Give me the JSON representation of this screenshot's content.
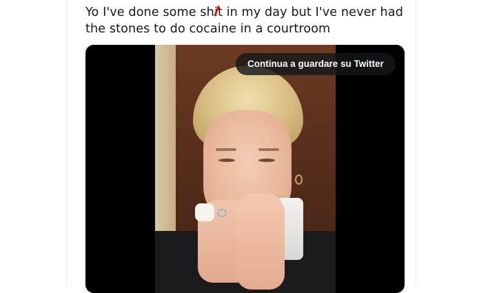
{
  "tweet": {
    "text_line1_before": "Yo I've done some sh",
    "text_line1_censored": "i",
    "text_line1_after": "t in my day but I've never had",
    "text_line2": "the stones to do cocaine in a courtroom"
  },
  "video": {
    "watch_on_twitter_label": "Continua a guardare su Twitter"
  },
  "colors": {
    "text": "#14171a",
    "censor_mark": "#e0191f",
    "overlay_bg": "#14171a",
    "divider": "#e6ecf0"
  }
}
